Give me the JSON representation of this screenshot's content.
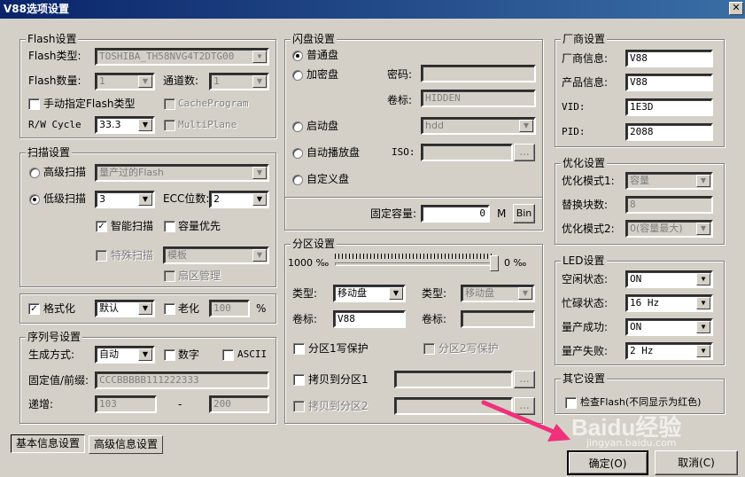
{
  "window": {
    "title": "V88选项设置",
    "close": "✕"
  },
  "flash": {
    "title": "Flash设置",
    "type_label": "Flash类型:",
    "type_value": "TOSHIBA_TH58NVG4T2DTG00",
    "count_label": "Flash数量:",
    "count_value": "1",
    "channels_label": "通道数:",
    "channels_value": "1",
    "manual_label": "手动指定Flash类型",
    "cacheprogram": "CacheProgram",
    "rw_label": "R/W Cycle",
    "rw_value": "33.3",
    "multiplane": "MultiPlane"
  },
  "scan": {
    "title": "扫描设置",
    "high_label": "高级扫描",
    "high_value": "量产过的Flash",
    "low_label": "低级扫描",
    "low_value": "3",
    "ecc_label": "ECC位数:",
    "ecc_value": "2",
    "smart_label": "智能扫描",
    "capacity_label": "容量优先",
    "special_label": "特殊扫描",
    "special_value": "模板",
    "sector_btn": "扇区管理"
  },
  "format": {
    "format_label": "格式化",
    "format_value": "默认",
    "aging_label": "老化",
    "aging_value": "100",
    "percent": "%"
  },
  "serial": {
    "title": "序列号设置",
    "gen_label": "生成方式:",
    "gen_value": "自动",
    "digits_label": "数字",
    "ascii_label": "ASCII",
    "fixed_label": "固定值/前缀:",
    "fixed_value": "CCCBBBBB111222333",
    "inc_label": "递增:",
    "inc_from": "103",
    "dash": "-",
    "inc_to": "200"
  },
  "disk": {
    "title": "闪盘设置",
    "normal": "普通盘",
    "encrypt": "加密盘",
    "password_label": "密码:",
    "label_label": "卷标:",
    "label_value": "HIDDEN",
    "boot": "启动盘",
    "boot_value": "hdd",
    "autoplay": "自动播放盘",
    "iso_label": "ISO:",
    "browse": "...",
    "custom": "自定义盘",
    "fixed_cap_label": "固定容量:",
    "fixed_cap_value": "0",
    "unit": "M",
    "bin_btn": "Bin"
  },
  "partition": {
    "title": "分区设置",
    "left_scale": "1000 ‰",
    "right_scale": "0 ‰",
    "type_label": "类型:",
    "type_value": "移动盘",
    "type2_label": "类型:",
    "type2_value": "移动盘",
    "vol_label": "卷标:",
    "vol_value": "V88",
    "vol2_label": "卷标:",
    "wp1": "分区1写保护",
    "wp2": "分区2写保护",
    "copy1": "拷贝到分区1",
    "copy2": "拷贝到分区2",
    "browse": "..."
  },
  "vendor": {
    "title": "厂商设置",
    "info_label": "厂商信息:",
    "info_value": "V88",
    "product_label": "产品信息:",
    "product_value": "V88",
    "vid_label": "VID:",
    "vid_value": "1E3D",
    "pid_label": "PID:",
    "pid_value": "2088"
  },
  "optimize": {
    "title": "优化设置",
    "mode1_label": "优化模式1:",
    "mode1_value": "容量",
    "replace_label": "替换块数:",
    "replace_value": "8",
    "mode2_label": "优化模式2:",
    "mode2_value": "0(容量最大)"
  },
  "led": {
    "title": "LED设置",
    "idle_label": "空闲状态:",
    "idle_value": "ON",
    "busy_label": "忙碌状态:",
    "busy_value": "16 Hz",
    "success_label": "量产成功:",
    "success_value": "ON",
    "fail_label": "量产失败:",
    "fail_value": "2 Hz"
  },
  "other": {
    "title": "其它设置",
    "check_label": "检查Flash(不同显示为红色)"
  },
  "tabs": {
    "basic": "基本信息设置",
    "advanced": "高级信息设置"
  },
  "buttons": {
    "ok": "确定(O)",
    "cancel": "取消(C)"
  },
  "watermark": {
    "brand": "Baidu经验",
    "url": "jingyan.baidu.com"
  },
  "colors": {
    "titlebar": "#0a246a",
    "arrow": "#f0307a",
    "face": "#d4d0c8"
  }
}
